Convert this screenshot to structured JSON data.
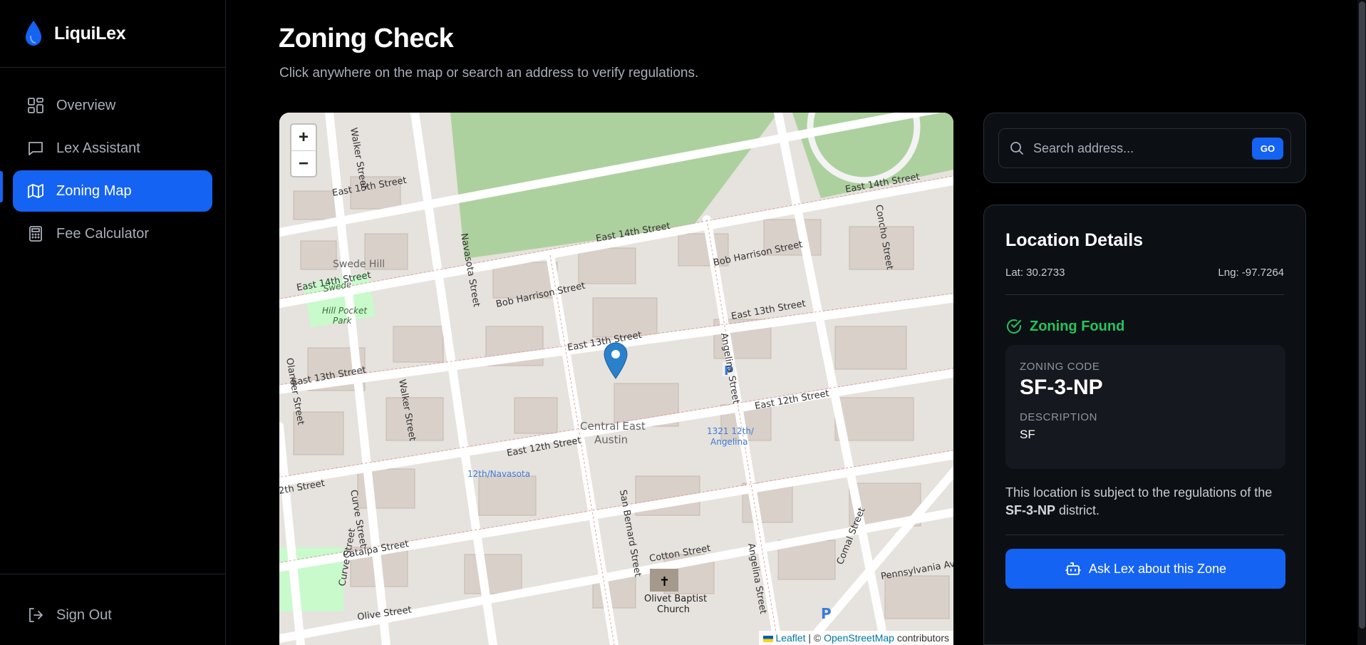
{
  "app": {
    "name": "LiquiLex"
  },
  "sidebar": {
    "items": [
      {
        "label": "Overview",
        "icon": "dashboard-grid-icon",
        "active": false
      },
      {
        "label": "Lex Assistant",
        "icon": "chat-bubble-icon",
        "active": false
      },
      {
        "label": "Zoning Map",
        "icon": "map-icon",
        "active": true
      },
      {
        "label": "Fee Calculator",
        "icon": "calculator-icon",
        "active": false
      }
    ],
    "sign_out": "Sign Out"
  },
  "page": {
    "title": "Zoning Check",
    "subtitle": "Click anywhere on the map or search an address to verify regulations."
  },
  "map": {
    "zoom_in": "+",
    "zoom_out": "−",
    "attribution": {
      "leaflet": "Leaflet",
      "separator": "| ©",
      "osm": "OpenStreetMap",
      "contributors": "contributors"
    },
    "labels": {
      "swede_hill": "Swede Hill",
      "park": "Swede Hill Pocket Park",
      "central_east_austin_1": "Central East",
      "central_east_austin_2": "Austin",
      "church_1": "Olivet Baptist",
      "church_2": "Church",
      "stop_a": "12th/Navasota",
      "stop_b_1": "1321 12th/",
      "stop_b_2": "Angelina",
      "e15": "East 15th Street",
      "e14a": "East 14th Street",
      "e14b": "East 14th Street",
      "e14c": "East 14th Street",
      "e13a": "East 13th Street",
      "e13b": "East 13th Street",
      "e13c": "East 13th Street",
      "e12a": "East 12th Street",
      "e12b": "East 12th Street",
      "e12c": "2th Street",
      "bh1": "Bob Harrison Street",
      "bh2": "Bob Harrison Street",
      "catalpa": "Catalpa Street",
      "cotton": "Cotton Street",
      "olive": "Olive Street",
      "navasota": "Navasota Street",
      "walker": "Walker Street",
      "walker2": "Walker Street",
      "olander": "Olander Street",
      "curve": "Curve Street",
      "curve2": "Curve Street",
      "sanbernard": "San Bernard Street",
      "angelina": "Angelina Street",
      "angelina2": "Angelina Street",
      "concho": "Concho Street",
      "comal": "Comal Street",
      "penn": "Pennsylvania Av"
    }
  },
  "search": {
    "placeholder": "Search address...",
    "go_label": "GO"
  },
  "details": {
    "title": "Location Details",
    "lat": "Lat: 30.2733",
    "lng": "Lng: -97.7264",
    "status": "Zoning Found",
    "zoning_code_label": "ZONING CODE",
    "zoning_code": "SF-3-NP",
    "description_label": "DESCRIPTION",
    "description": "SF",
    "reg_prefix": "This location is subject to the regulations of the",
    "reg_code": "SF-3-NP",
    "reg_suffix": "district.",
    "ask_button": "Ask Lex about this Zone"
  },
  "colors": {
    "accent": "#1463f3",
    "success": "#22c55e",
    "background": "#000000"
  }
}
